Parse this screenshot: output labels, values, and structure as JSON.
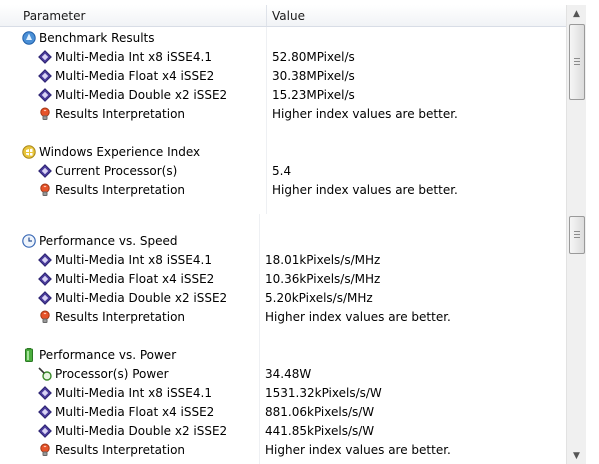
{
  "header": {
    "parameter": "Parameter",
    "value": "Value"
  },
  "top_groups": [
    {
      "title": "Benchmark Results",
      "icon": "benchmark-icon",
      "rows": [
        {
          "icon": "cpu-diamond-icon",
          "label": "Multi-Media Int x8 iSSE4.1",
          "value": "52.80MPixel/s"
        },
        {
          "icon": "cpu-diamond-icon",
          "label": "Multi-Media Float x4 iSSE2",
          "value": "30.38MPixel/s"
        },
        {
          "icon": "cpu-diamond-icon",
          "label": "Multi-Media Double x2 iSSE2",
          "value": "15.23MPixel/s"
        },
        {
          "icon": "lightbulb-icon",
          "label": "Results Interpretation",
          "value": "Higher index values are better."
        }
      ]
    },
    {
      "title": "Windows Experience Index",
      "icon": "windows-experience-icon",
      "rows": [
        {
          "icon": "cpu-diamond-icon",
          "label": "Current Processor(s)",
          "value": "5.4"
        },
        {
          "icon": "lightbulb-icon",
          "label": "Results Interpretation",
          "value": "Higher index values are better."
        }
      ]
    }
  ],
  "bottom_groups": [
    {
      "title": "Performance vs. Speed",
      "icon": "clock-icon",
      "rows": [
        {
          "icon": "cpu-diamond-icon",
          "label": "Multi-Media Int x8 iSSE4.1",
          "value": "18.01kPixels/s/MHz"
        },
        {
          "icon": "cpu-diamond-icon",
          "label": "Multi-Media Float x4 iSSE2",
          "value": "10.36kPixels/s/MHz"
        },
        {
          "icon": "cpu-diamond-icon",
          "label": "Multi-Media Double x2 iSSE2",
          "value": "5.20kPixels/s/MHz"
        },
        {
          "icon": "lightbulb-icon",
          "label": "Results Interpretation",
          "value": "Higher index values are better."
        }
      ]
    },
    {
      "title": "Performance vs. Power",
      "icon": "battery-icon",
      "rows": [
        {
          "icon": "power-probe-icon",
          "label": "Processor(s) Power",
          "value": "34.48W"
        },
        {
          "icon": "cpu-diamond-icon",
          "label": "Multi-Media Int x8 iSSE4.1",
          "value": "1531.32kPixels/s/W"
        },
        {
          "icon": "cpu-diamond-icon",
          "label": "Multi-Media Float x4 iSSE2",
          "value": "881.06kPixels/s/W"
        },
        {
          "icon": "cpu-diamond-icon",
          "label": "Multi-Media Double x2 iSSE2",
          "value": "441.85kPixels/s/W"
        },
        {
          "icon": "lightbulb-icon",
          "label": "Results Interpretation",
          "value": "Higher index values are better."
        }
      ]
    }
  ],
  "scrollbar": {
    "up_arrow": "▲",
    "down_arrow": "▼"
  }
}
